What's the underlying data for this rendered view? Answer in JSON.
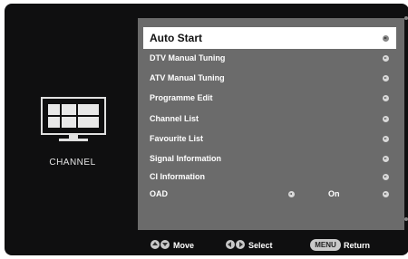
{
  "sidebar": {
    "caption": "CHANNEL",
    "icon": "tv-icon"
  },
  "menu": {
    "items": [
      {
        "label": "Auto Start",
        "selected": true
      },
      {
        "label": "DTV Manual Tuning"
      },
      {
        "label": "ATV Manual Tuning"
      },
      {
        "label": "Programme Edit"
      },
      {
        "label": "Channel List"
      },
      {
        "label": "Favourite List"
      },
      {
        "label": "Signal Information"
      },
      {
        "label": "CI Information"
      },
      {
        "label": "OAD",
        "value": "On"
      }
    ]
  },
  "footer": {
    "move_label": "Move",
    "select_label": "Select",
    "menu_key": "MENU",
    "return_label": "Return"
  },
  "colors": {
    "background": "#0f0f10",
    "panel": "#6b6b6b",
    "highlight": "#ffffff"
  }
}
